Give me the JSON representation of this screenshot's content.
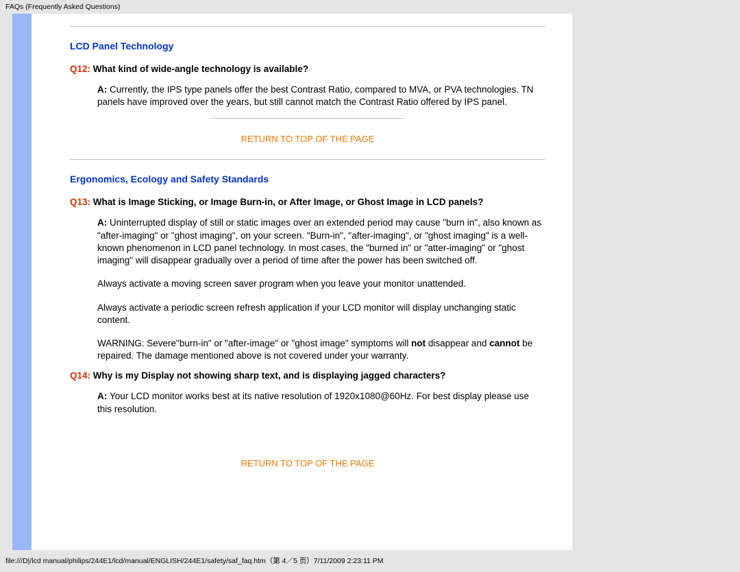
{
  "header": {
    "title": "FAQs (Frequently Asked Questions)"
  },
  "sections": {
    "s1": {
      "heading": "LCD Panel Technology"
    },
    "s2": {
      "heading": "Ergonomics, Ecology and Safety Standards"
    }
  },
  "q12": {
    "label": "Q12:",
    "text": " What kind of wide-angle technology is available?"
  },
  "a12": {
    "label": "A: ",
    "text": "Currently, the IPS type panels offer the best Contrast Ratio, compared to MVA, or PVA technologies.  TN panels have improved over the years, but still cannot match the Contrast Ratio offered by IPS panel."
  },
  "toplink": {
    "text": "RETURN TO TOP OF THE PAGE"
  },
  "q13": {
    "label": "Q13:",
    "text": " What is Image Sticking, or Image Burn-in, or After Image, or Ghost Image in LCD panels?"
  },
  "a13": {
    "label": "A: ",
    "text": "Uninterrupted display of still or static images over an extended period may cause \"burn in\", also known as \"after-imaging\" or \"ghost imaging\", on your screen. \"Burn-in\", \"after-imaging\", or \"ghost imaging\" is a well-known phenomenon in LCD panel technology. In most cases, the \"burned in\" or \"atter-imaging\" or \"ghost imaging\" will disappear gradually over a period of time after the power has been switched off.",
    "p2": "Always activate a moving screen saver program when you leave your monitor unattended.",
    "p3": "Always activate a periodic screen refresh application if your LCD monitor will display unchanging static content.",
    "warn_a": "WARNING: Severe\"burn-in\" or \"after-image\" or \"ghost image\" symptoms will ",
    "warn_not": "not",
    "warn_b": " disappear and ",
    "warn_cannot": "cannot",
    "warn_c": " be repaired. The damage mentioned above is not covered under your warranty."
  },
  "q14": {
    "label": "Q14:",
    "text": " Why is my Display not showing sharp text, and is displaying jagged characters?"
  },
  "a14": {
    "label": "A: ",
    "text": "Your LCD monitor works best at its native resolution of 1920x1080@60Hz. For best display please use this resolution."
  },
  "footer": {
    "text": "file:///D|/lcd manual/philips/244E1/lcd/manual/ENGLISH/244E1/safety/saf_faq.htm（第 4／5 页）7/11/2009 2:23:11 PM"
  }
}
